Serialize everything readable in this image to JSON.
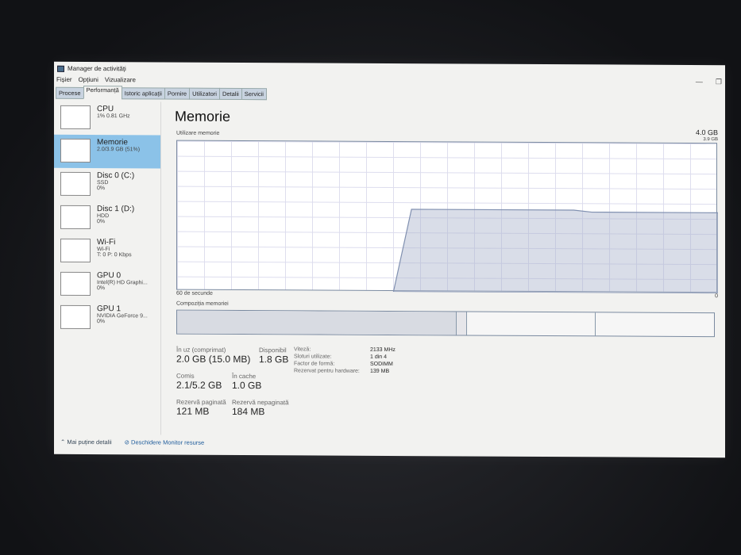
{
  "window": {
    "title": "Manager de activități"
  },
  "menu": [
    "Fișier",
    "Opțiuni",
    "Vizualizare"
  ],
  "tabs": [
    "Procese",
    "Performanță",
    "Istoric aplicații",
    "Pornire",
    "Utilizatori",
    "Detalii",
    "Servicii"
  ],
  "active_tab": 1,
  "sidebar": [
    {
      "name": "CPU",
      "l1": "1% 0.81 GHz",
      "l2": "",
      "l3": ""
    },
    {
      "name": "Memorie",
      "l1": "2.0/3.9 GB (51%)",
      "l2": "",
      "l3": ""
    },
    {
      "name": "Disc 0 (C:)",
      "l1": "SSD",
      "l2": "0%",
      "l3": ""
    },
    {
      "name": "Disc 1 (D:)",
      "l1": "HDD",
      "l2": "0%",
      "l3": ""
    },
    {
      "name": "Wi-Fi",
      "l1": "Wi-Fi",
      "l2": "T: 0 P: 0 Kbps",
      "l3": ""
    },
    {
      "name": "GPU 0",
      "l1": "Intel(R) HD Graphi...",
      "l2": "0%",
      "l3": ""
    },
    {
      "name": "GPU 1",
      "l1": "NVIDIA GeForce 9...",
      "l2": "0%",
      "l3": ""
    }
  ],
  "main": {
    "title": "Memorie",
    "total": "4.0 GB",
    "graph_label": "Utilizare memorie",
    "graph_max": "3.9 GB",
    "time_label": "60 de secunde",
    "zero": "0",
    "composition_label": "Compoziția memoriei"
  },
  "chart_data": {
    "type": "area",
    "xlabel": "60 de secunde",
    "ylabel": "Utilizare memorie",
    "ylim": [
      0,
      3.9
    ],
    "x": [
      60,
      36,
      34,
      16,
      14,
      0
    ],
    "values": [
      null,
      0,
      2.15,
      2.15,
      2.1,
      2.1
    ]
  },
  "composition": {
    "in_use_fraction": 0.52,
    "modified_fraction": 0.02,
    "standby_fraction": 0.24
  },
  "stats": {
    "in_use_label": "În uz (comprimat)",
    "in_use": "2.0 GB (15.0 MB)",
    "available_label": "Disponibil",
    "available": "1.8 GB",
    "committed_label": "Comis",
    "committed": "2.1/5.2 GB",
    "cached_label": "În cache",
    "cached": "1.0 GB",
    "paged_label": "Rezervă paginată",
    "paged": "121 MB",
    "nonpaged_label": "Rezervă nepaginată",
    "nonpaged": "184 MB"
  },
  "hw": [
    {
      "k": "Viteză:",
      "v": "2133 MHz"
    },
    {
      "k": "Sloturi utilizate:",
      "v": "1 din 4"
    },
    {
      "k": "Factor de formă:",
      "v": "SODIMM"
    },
    {
      "k": "Rezervat pentru hardware:",
      "v": "139 MB"
    }
  ],
  "footer": {
    "fewer": "Mai puține detalii",
    "monitor": "Deschidere Monitor resurse"
  }
}
